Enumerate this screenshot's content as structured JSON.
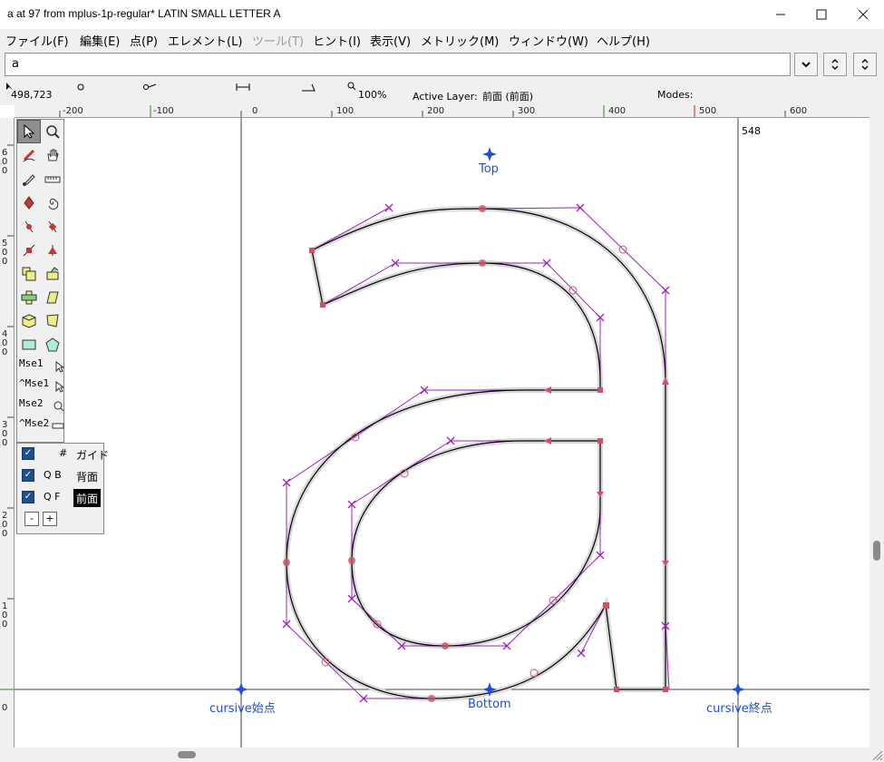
{
  "window": {
    "title": "a at 97 from mplus-1p-regular* LATIN SMALL LETTER A",
    "minimize_label": "—",
    "maximize_label": "☐",
    "close_label": "✕"
  },
  "menu": [
    {
      "label": "ファイル(F)",
      "disabled": false
    },
    {
      "label": "編集(E)",
      "disabled": false
    },
    {
      "label": "点(P)",
      "disabled": false
    },
    {
      "label": "エレメント(L)",
      "disabled": false
    },
    {
      "label": "ツール(T)",
      "disabled": true
    },
    {
      "label": "ヒント(I)",
      "disabled": false
    },
    {
      "label": "表示(V)",
      "disabled": false
    },
    {
      "label": "メトリック(M)",
      "disabled": false
    },
    {
      "label": "ウィンドウ(W)",
      "disabled": false
    },
    {
      "label": "ヘルプ(H)",
      "disabled": false
    }
  ],
  "glyph_field": {
    "value": "a"
  },
  "info": {
    "coords": "498,723",
    "zoom": "100%",
    "active_layer_label": "Active Layer:",
    "active_layer_value": "前面 (前面)",
    "modes_label": "Modes:"
  },
  "ruler_top": [
    "-200",
    "-100",
    "0",
    "100",
    "200",
    "300",
    "400",
    "500",
    "600"
  ],
  "ruler_left": [
    "6\n0\n0",
    "5\n0\n0",
    "4\n0\n0",
    "3\n0\n0",
    "2\n0\n0",
    "1\n0\n0",
    "0"
  ],
  "tools": {
    "mse1": "Mse1",
    "ctrl_mse1": "^Mse1",
    "mse2": "Mse2",
    "ctrl_mse2": "^Mse2"
  },
  "layers": [
    {
      "checked": true,
      "flags": "#",
      "name": "ガイド",
      "active": false
    },
    {
      "checked": true,
      "flags": "Q B",
      "name": "背面",
      "active": false
    },
    {
      "checked": true,
      "flags": "Q F",
      "name": "前面",
      "active": true
    }
  ],
  "layer_buttons": {
    "remove": "-",
    "add": "+"
  },
  "anchors": {
    "top": "Top",
    "bottom": "Bottom",
    "cursive_start": "cursive始点",
    "cursive_end": "cursive終点"
  },
  "advance_width": "548",
  "colors": {
    "outline": "#000000",
    "anchor": "#1d4fd6",
    "control_handle": "#a020c0",
    "point": "#d0506a"
  }
}
